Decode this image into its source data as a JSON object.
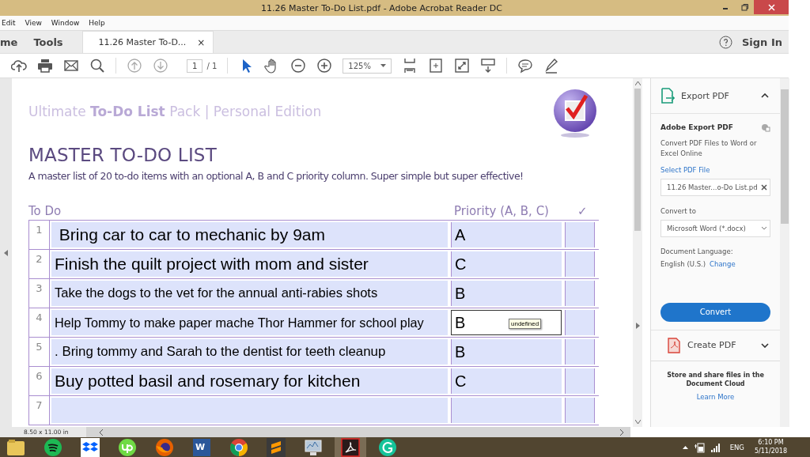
{
  "window": {
    "title": "11.26 Master To-Do List.pdf - Adobe Acrobat Reader DC"
  },
  "menu": [
    "Edit",
    "View",
    "Window",
    "Help"
  ],
  "tabs": [
    {
      "label": "me",
      "selected": false
    },
    {
      "label": "Tools",
      "selected": false
    },
    {
      "label": "11.26 Master To-D...",
      "selected": true,
      "close": "×"
    }
  ],
  "sign_in": "Sign In",
  "toolbar": {
    "page": "1",
    "page_total": "/ 1",
    "zoom": "125%"
  },
  "document": {
    "heading": "Ultimate **To-Do List** Pack | Personal Edition",
    "title": "MASTER TO-DO LIST",
    "description": "A master list of 20 to-do items with an optional A, B and C priority column. Super simple but super effective!",
    "columns": [
      "To Do",
      "Priority (A, B, C)",
      "✓"
    ],
    "rows": [
      {
        "num": "1",
        "task": " Bring car to car to mechanic by 9am",
        "priority": "A",
        "selected": false
      },
      {
        "num": "2",
        "task": "Finish the quilt project with mom and sister",
        "priority": "C",
        "selected": false
      },
      {
        "num": "3",
        "task": "Take the dogs to the vet for the annual anti-rabies shots",
        "priority": "B",
        "selected": false
      },
      {
        "num": "4",
        "task": "Help Tommy to make paper mache Thor Hammer for school play",
        "priority": "B",
        "selected": true,
        "tooltip": "undefined"
      },
      {
        "num": "5",
        "task": ". Bring tommy and Sarah to the dentist for teeth cleanup",
        "priority": "B",
        "selected": false
      },
      {
        "num": "6",
        "task": "Buy potted basil and rosemary for kitchen",
        "priority": "C",
        "selected": false
      },
      {
        "num": "7",
        "selected": false
      }
    ]
  },
  "status_bar": {
    "page_size": "8.50 x 11.00 in"
  },
  "panel": {
    "export_title": "Export PDF",
    "section_title": "Adobe Export PDF",
    "description": "Convert PDF Files to Word or Excel Online",
    "select_label": "Select PDF File",
    "file": "11.26 Master...o-Do List.pd",
    "convert_label": "Convert to",
    "convert_value": "Microsoft Word (*.docx)",
    "language_label": "Document Language:",
    "language": "English (U.S.)",
    "change": "Change",
    "convert_button": "Convert",
    "create_title": "Create PDF",
    "cloud_text": "Store and share files in the Document Cloud",
    "learn_more": "Learn More"
  },
  "taskbar": {
    "apps": [
      {
        "kind": "explorer",
        "selected": false
      },
      {
        "kind": "spotify",
        "selected": false
      },
      {
        "kind": "dropbox",
        "selected": false
      },
      {
        "kind": "upwork",
        "selected": false
      },
      {
        "kind": "firefox",
        "selected": false
      },
      {
        "kind": "word",
        "label": "W",
        "selected": false
      },
      {
        "kind": "chrome",
        "selected": false
      },
      {
        "kind": "sublime",
        "selected": false
      },
      {
        "kind": "monitor",
        "selected": false
      },
      {
        "kind": "acrobat",
        "selected": true
      },
      {
        "kind": "grammarly",
        "selected": false
      }
    ],
    "language": "ENG",
    "time": "6:10 PM",
    "date": "5/11/2018"
  }
}
